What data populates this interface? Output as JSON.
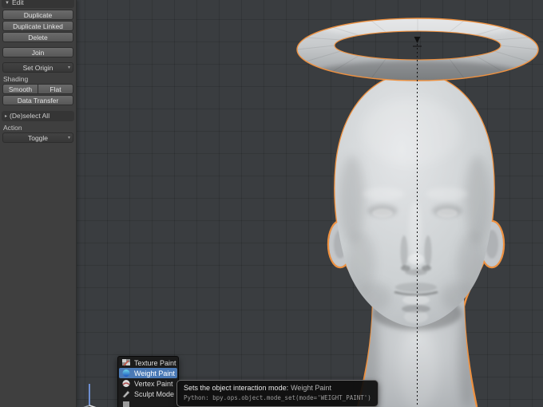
{
  "tool_shelf": {
    "edit_panel_header": "Edit",
    "buttons": {
      "duplicate": "Duplicate",
      "duplicate_linked": "Duplicate Linked",
      "delete": "Delete",
      "join": "Join",
      "set_origin": "Set Origin",
      "smooth": "Smooth",
      "flat": "Flat",
      "data_transfer": "Data Transfer",
      "toggle": "Toggle"
    },
    "labels": {
      "shading": "Shading",
      "action": "Action"
    },
    "deselect_panel_header": "(De)select All"
  },
  "icons": {
    "panel_expanded": "▼",
    "panel_collapsed": "▸",
    "dropdown_arrow": "▾"
  },
  "mode_menu": {
    "items": [
      {
        "label": "Texture Paint",
        "icon": "texture-paint-icon"
      },
      {
        "label": "Weight Paint",
        "icon": "weight-paint-icon"
      },
      {
        "label": "Vertex Paint",
        "icon": "vertex-paint-icon"
      },
      {
        "label": "Sculpt Mode",
        "icon": "sculpt-mode-icon"
      }
    ],
    "selected": "Weight Paint"
  },
  "tooltip": {
    "label": "Sets the object interaction mode:",
    "value": "Weight Paint",
    "python": "Python: bpy.ops.object.mode_set(mode='WEIGHT_PAINT')"
  },
  "colors": {
    "selection_outline": "#ee9140",
    "menu_highlight": "#4a79b5",
    "viewport_bg": "#3a3d40",
    "shelf_bg": "#3f3f3f"
  }
}
